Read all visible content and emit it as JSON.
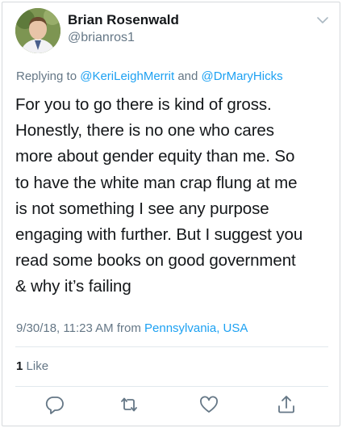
{
  "author": {
    "display_name": "Brian Rosenwald",
    "handle": "@brianros1"
  },
  "reply": {
    "prefix": "Replying to",
    "user1": "@KeriLeighMerrit",
    "conjunction": "and",
    "user2": "@DrMaryHicks"
  },
  "tweet": {
    "lines": [
      "For you to go there is kind of gross.",
      "Honestly, there is no one who cares",
      "more about gender equity than me. So",
      "to have the white man crap flung at me",
      "is not something I see any purpose",
      "engaging with further. But I suggest you",
      "read some books on good government",
      "& why it’s failing"
    ]
  },
  "meta": {
    "timestamp": "9/30/18, 11:23 AM",
    "from_label": "from",
    "location": "Pennsylvania, USA"
  },
  "engagement": {
    "like_count": "1",
    "like_label": "Like"
  },
  "actions": [
    "reply-icon",
    "retweet-icon",
    "like-icon",
    "share-icon"
  ],
  "colors": {
    "link": "#1da1f2",
    "muted": "#657786",
    "text": "#14171a",
    "divider": "#e1e8ed"
  }
}
